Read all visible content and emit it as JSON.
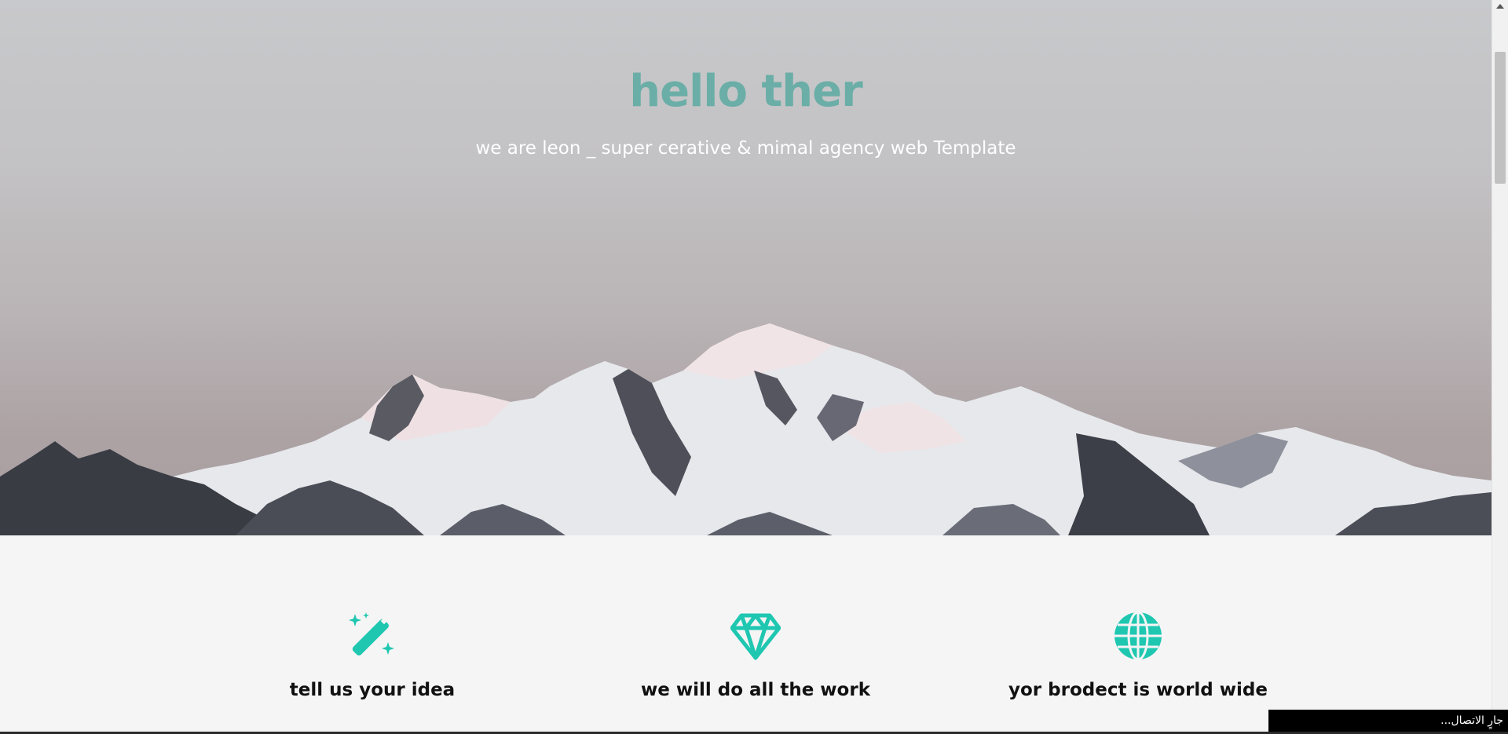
{
  "hero": {
    "title": "hello ther",
    "subtitle": "we are leon _ super cerative & mimal agency web Template"
  },
  "colors": {
    "accent": "#1fc7b1",
    "title": "#6aaea7"
  },
  "features": [
    {
      "icon": "magic-wand-icon",
      "title": "tell us your idea"
    },
    {
      "icon": "diamond-icon",
      "title": "we will do all the work"
    },
    {
      "icon": "globe-icon",
      "title": "yor brodect is world wide"
    }
  ],
  "status": {
    "text": "جارٍ الاتصال..."
  }
}
